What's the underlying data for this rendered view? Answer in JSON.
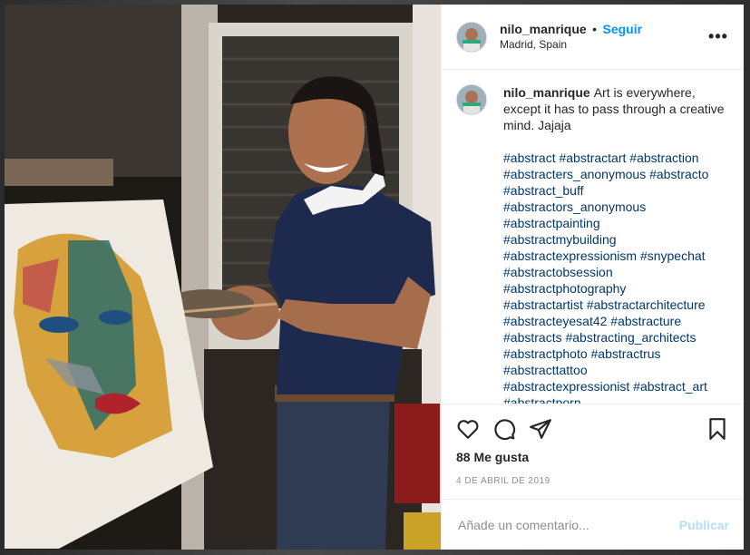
{
  "colors": {
    "accent": "#0095f6",
    "hashtag": "#00376b",
    "publish_disabled": "#b2dffc",
    "text": "#262626",
    "muted": "#8e8e8e"
  },
  "header": {
    "username": "nilo_manrique",
    "separator": "•",
    "follow_label": "Seguir",
    "location": "Madrid, Spain",
    "more_icon": "more-options-icon",
    "more_label": "•••"
  },
  "caption": {
    "username": "nilo_manrique",
    "text": "Art is everywhere, except it has to pass through a creative mind. Jajaja",
    "hashtags": "#abstract #abstractart #abstraction\n#abstracters_anonymous #abstracto\n#abstract_buff\n#abstractors_anonymous\n#abstractpainting\n#abstractmybuilding\n#abstractexpressionism #snypechat\n#abstractobsession\n#abstractphotography\n#abstractartist #abstractarchitecture\n#abstracteyesat42 #abstracture\n#abstracts #abstracting_architects\n#abstractphoto #abstractrus\n#abstracttattoo\n#abstractexpressionist #abstract_art\n#abstractporn"
  },
  "actions": {
    "icons": [
      "heart-icon",
      "comment-icon",
      "share-icon",
      "bookmark-icon"
    ],
    "likes": "88 Me gusta",
    "date": "4 DE ABRIL DE 2019"
  },
  "comment_box": {
    "placeholder": "Añade un comentario...",
    "publish_label": "Publicar"
  }
}
